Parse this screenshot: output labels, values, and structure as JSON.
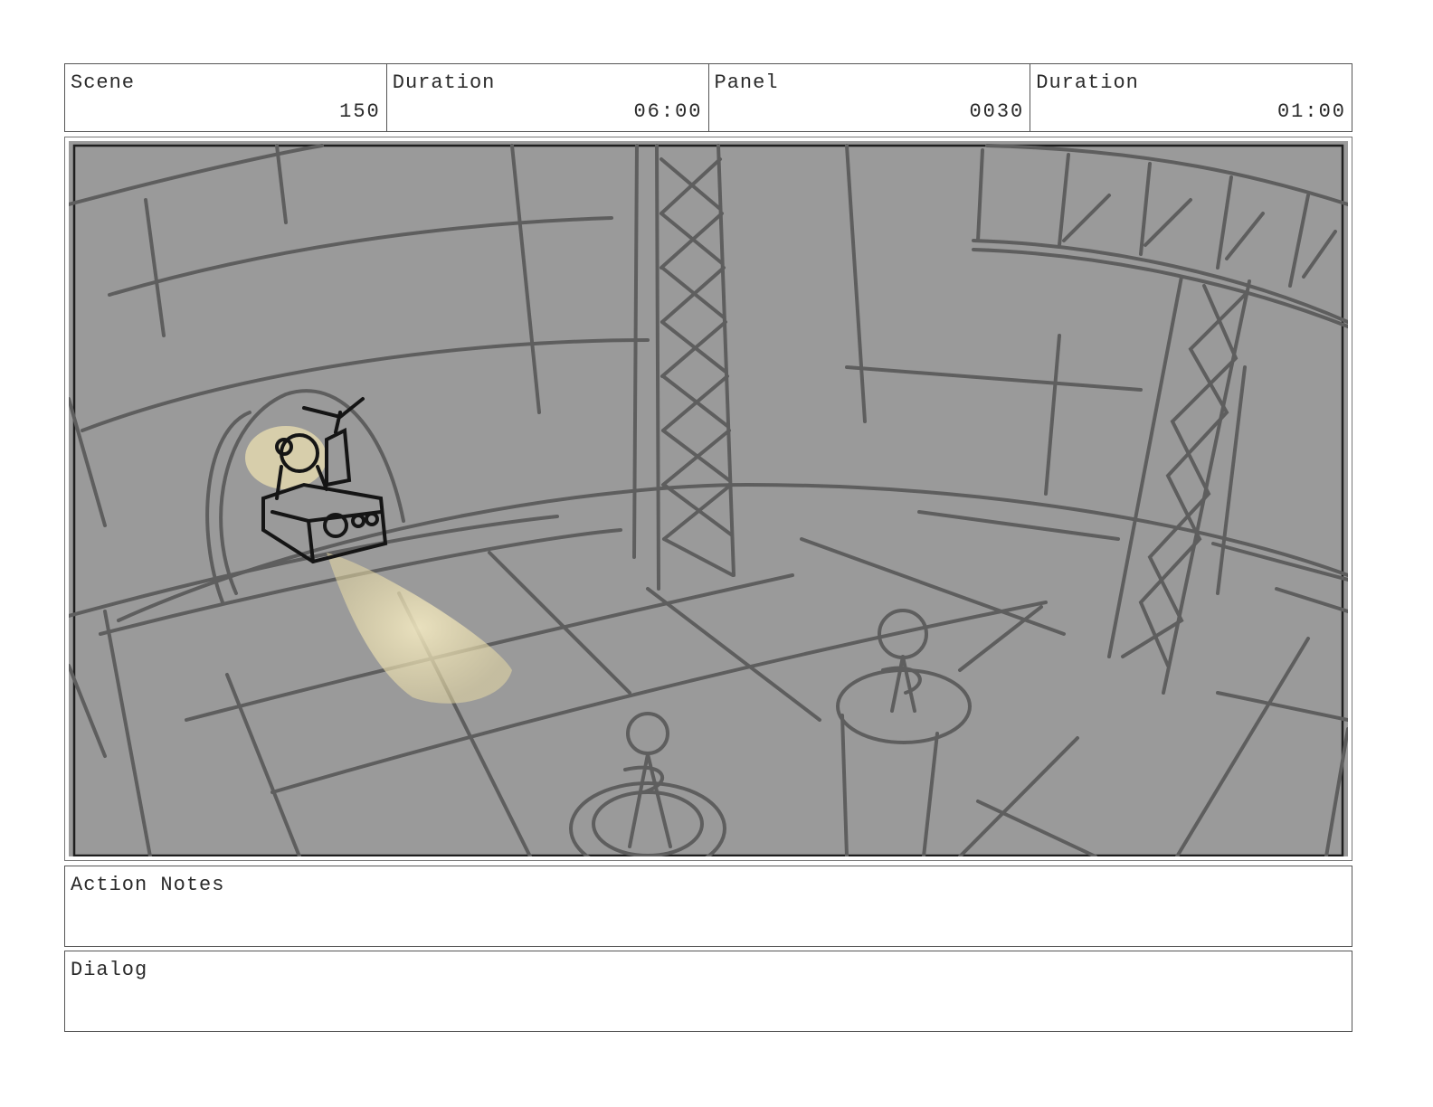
{
  "header": {
    "scene_label": "Scene",
    "scene_value": "150",
    "scene_duration_label": "Duration",
    "scene_duration_value": "06:00",
    "panel_label": "Panel",
    "panel_value": "0030",
    "panel_duration_label": "Duration",
    "panel_duration_value": "01:00"
  },
  "action_notes": {
    "label": "Action Notes"
  },
  "dialog": {
    "label": "Dialog"
  },
  "colors": {
    "panel_bg": "#9a9a9a",
    "sketch_line": "#5e5e5e",
    "light_beam": "#f3e7b8"
  }
}
